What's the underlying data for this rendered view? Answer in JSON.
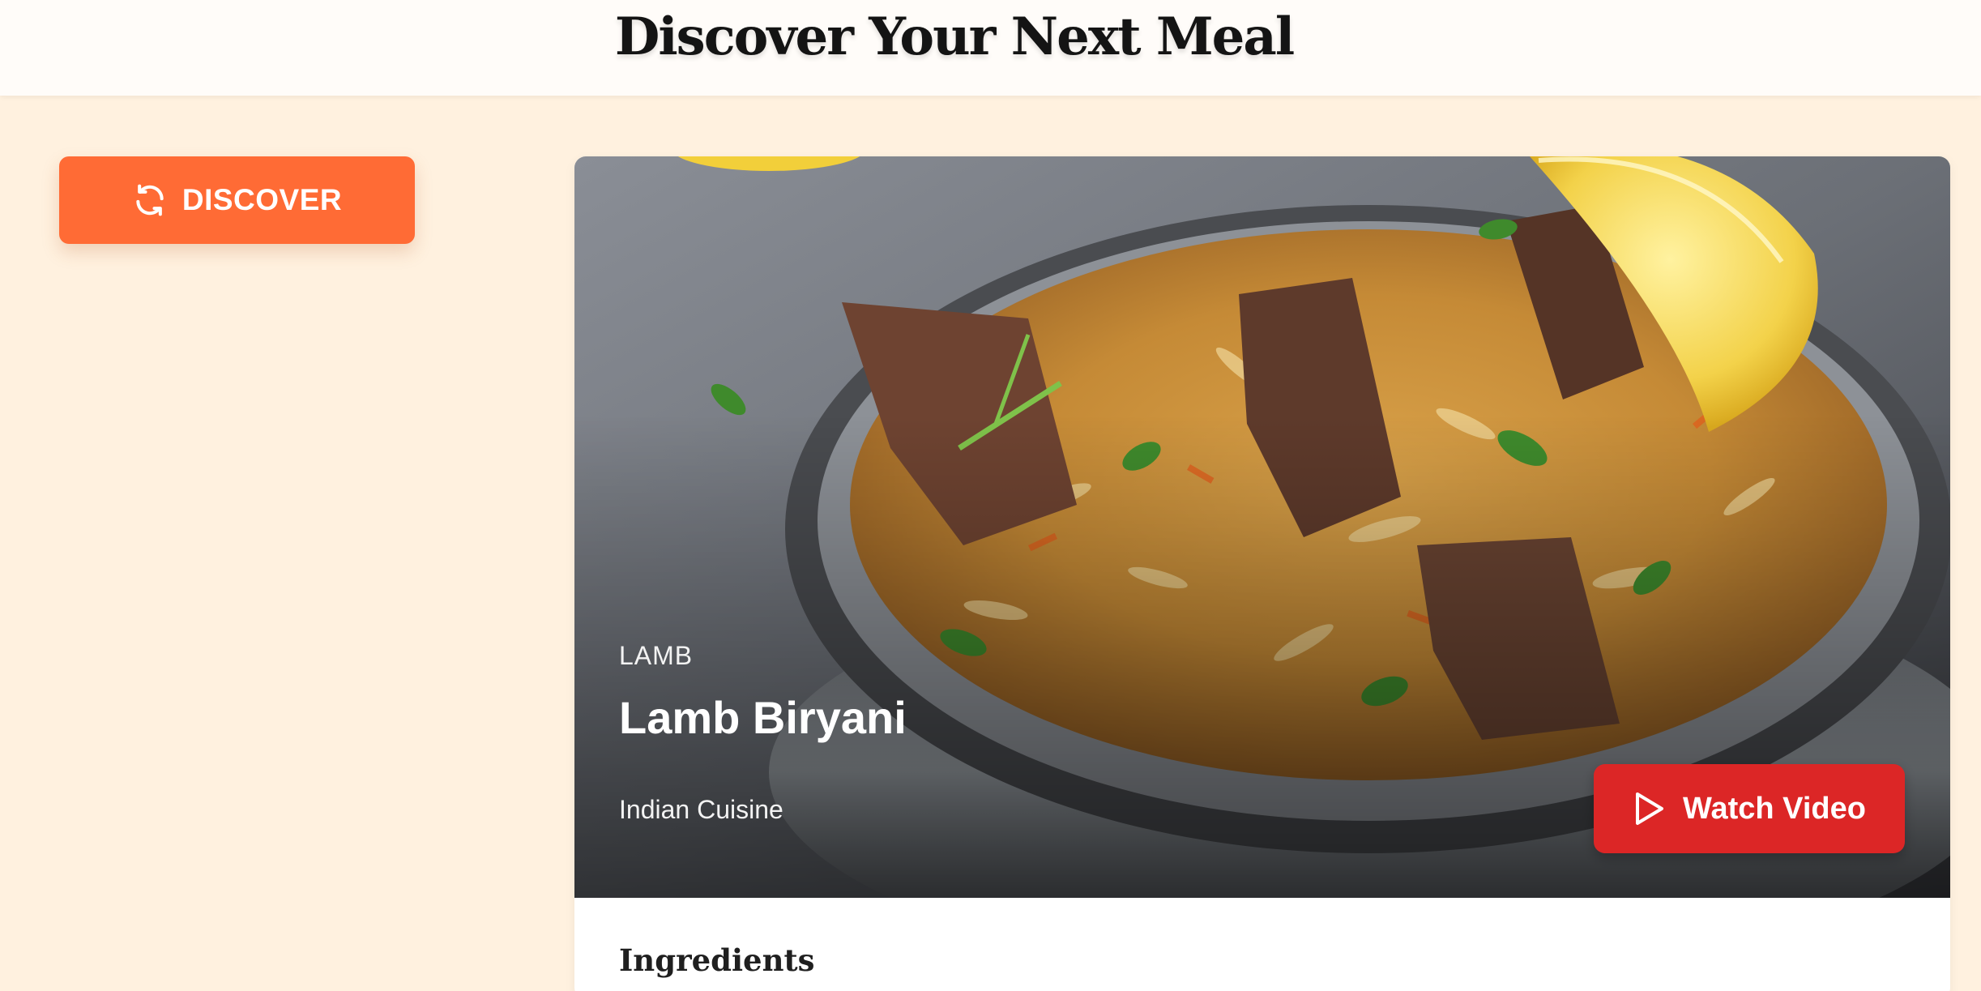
{
  "header": {
    "title": "Discover Your Next Meal"
  },
  "sidebar": {
    "discover_button": {
      "label": "DISCOVER",
      "icon": "refresh-icon"
    }
  },
  "meal": {
    "category": "LAMB",
    "name": "Lamb Biryani",
    "cuisine": "Indian Cuisine",
    "watch_button": {
      "label": "Watch Video",
      "icon": "play-icon"
    },
    "ingredients_heading": "Ingredients"
  },
  "colors": {
    "page_background": "#fff1df",
    "header_background": "#fffcf9",
    "discover_button": "#ff6b35",
    "watch_button": "#dc2626"
  }
}
